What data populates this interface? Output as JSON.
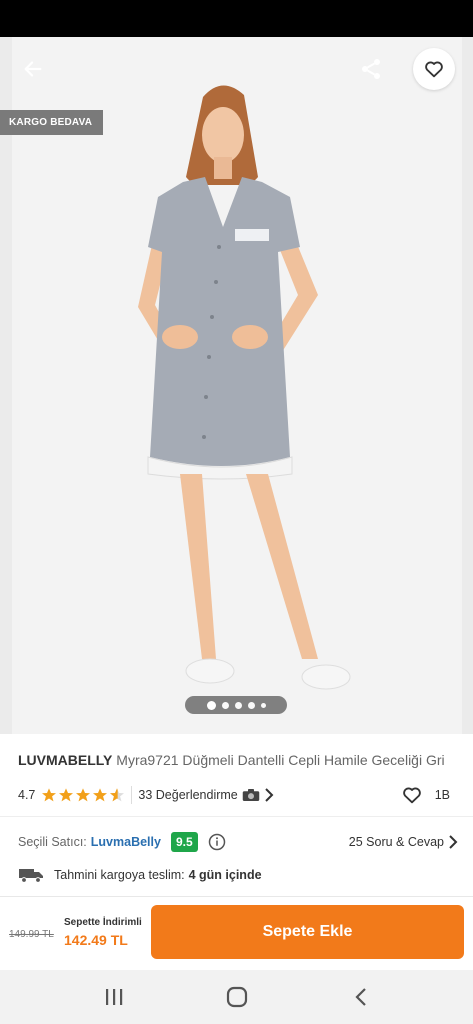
{
  "hero": {
    "badge": "KARGO BEDAVA",
    "pager": {
      "count": 5,
      "active_index": 0
    }
  },
  "product": {
    "brand": "LUVMABELLY",
    "name": "Myra9721 Düğmeli Dantelli Cepli Hamile Geceliği Gri",
    "rating": "4.7",
    "rating_value": 4.7,
    "review_count": "33 Değerlendirme",
    "like_count": "1B"
  },
  "seller": {
    "label": "Seçili Satıcı:",
    "name": "LuvmaBelly",
    "score": "9.5",
    "qa_link": "25 Soru & Cevap"
  },
  "delivery": {
    "label": "Tahmini kargoya teslim:",
    "value": "4 gün içinde"
  },
  "purchase": {
    "old_price": "149.99 TL",
    "discount_label": "Sepette İndirimli",
    "new_price": "142.49 TL",
    "button_label": "Sepete Ekle"
  },
  "colors": {
    "accent": "#f27a1a",
    "star": "#f2a01a",
    "seller_score_bg": "#1fa64a",
    "seller_link": "#2a6fb0"
  },
  "icons": {
    "back": "arrow-left-icon",
    "share": "share-icon",
    "favorite": "heart-icon",
    "camera": "camera-icon",
    "info": "info-icon",
    "truck": "truck-icon",
    "nav": [
      "recent-apps-icon",
      "home-icon",
      "back-nav-icon"
    ]
  }
}
